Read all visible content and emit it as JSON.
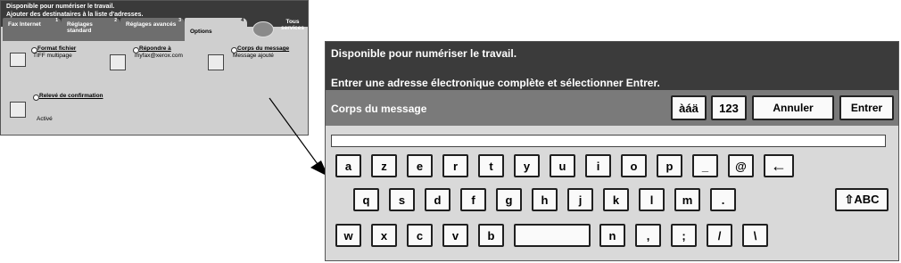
{
  "small_panel": {
    "status": "Disponible pour numériser le travail.",
    "instruction": "Ajouter des destinataires à la liste d'adresses.",
    "tabs": [
      {
        "label": "Fax Internet",
        "num": "1"
      },
      {
        "label": "Réglages standard",
        "num": "2"
      },
      {
        "label": "Réglages avancés",
        "num": "3"
      },
      {
        "label": "Options",
        "num": "4"
      }
    ],
    "services_label": "Tous services",
    "options": {
      "format": {
        "title": "Format fichier",
        "value": "TIFF multipage"
      },
      "reply": {
        "title": "Répondre à",
        "value": "myfax@xerox.com"
      },
      "body": {
        "title": "Corps du message",
        "value": "Message ajouté"
      },
      "confirm": {
        "title": "Relevé de confirmation",
        "value": "Activé"
      }
    }
  },
  "large_panel": {
    "status": "Disponible pour numériser le travail.",
    "instruction": "Entrer une adresse électronique complète et sélectionner Entrer.",
    "field_label": "Corps du message",
    "buttons": {
      "accent": "àáä",
      "numeric": "123",
      "cancel": "Annuler",
      "enter": "Entrer"
    },
    "text_value": "",
    "keyboard": {
      "row1": [
        "a",
        "z",
        "e",
        "r",
        "t",
        "y",
        "u",
        "i",
        "o",
        "p",
        "_",
        "@"
      ],
      "backspace_label": "←",
      "row2": [
        "q",
        "s",
        "d",
        "f",
        "g",
        "h",
        "j",
        "k",
        "l",
        "m",
        "."
      ],
      "shift_label": "⇧ABC",
      "row3a": [
        "w",
        "x",
        "c",
        "v",
        "b"
      ],
      "space_label": "",
      "row3b": [
        "n",
        ",",
        ";",
        "/",
        "\\"
      ]
    }
  },
  "colors": {
    "header_dark": "#3b3b3b",
    "toolbar_gray": "#7a7a7a",
    "panel_bg": "#d9d9d9",
    "key_bg": "#fafafa"
  }
}
